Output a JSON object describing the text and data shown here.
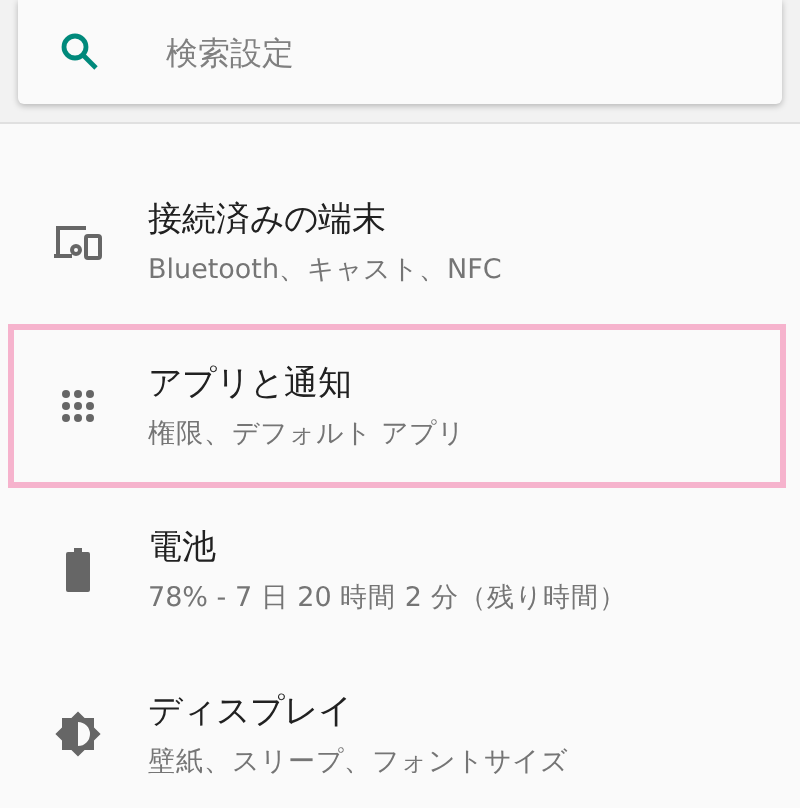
{
  "search": {
    "placeholder": "検索設定"
  },
  "items": [
    {
      "kind": "devices",
      "title": "接続済みの端末",
      "summary": "Bluetooth、キャスト、NFC",
      "selected": false
    },
    {
      "kind": "apps",
      "title": "アプリと通知",
      "summary": "権限、デフォルト アプリ",
      "selected": true
    },
    {
      "kind": "battery",
      "title": "電池",
      "summary": "78% - 7 日 20 時間 2 分（残り時間）",
      "selected": false
    },
    {
      "kind": "display",
      "title": "ディスプレイ",
      "summary": "壁紙、スリープ、フォントサイズ",
      "selected": false
    }
  ]
}
